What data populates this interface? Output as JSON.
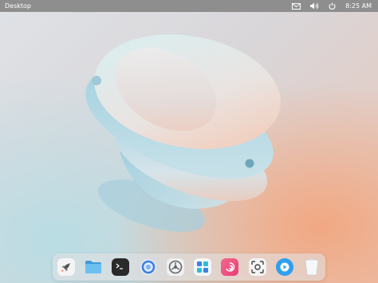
{
  "topbar": {
    "title": "Desktop",
    "clock": "8:25 AM",
    "tray_icons": [
      "notification-icon",
      "volume-icon",
      "power-icon"
    ]
  },
  "dock": {
    "items": [
      {
        "name": "launcher",
        "icon": "rocket-icon"
      },
      {
        "name": "file-manager",
        "icon": "folder-icon"
      },
      {
        "name": "terminal",
        "icon": "terminal-icon"
      },
      {
        "name": "browser",
        "icon": "browser-icon"
      },
      {
        "name": "settings",
        "icon": "gear-icon"
      },
      {
        "name": "app-store",
        "icon": "app-store-icon"
      },
      {
        "name": "debian-app",
        "icon": "debian-icon"
      },
      {
        "name": "screenshot",
        "icon": "screenshot-icon"
      },
      {
        "name": "video-player",
        "icon": "play-icon"
      },
      {
        "name": "trash",
        "icon": "trash-icon"
      }
    ]
  },
  "colors": {
    "topbar": "#8e8e8f",
    "wallpaper_accent": "#f1a882"
  }
}
